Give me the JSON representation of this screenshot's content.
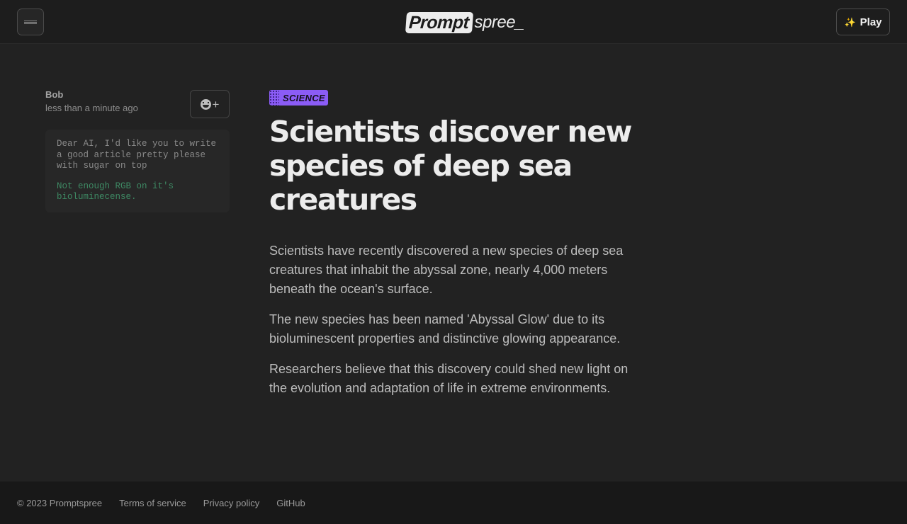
{
  "header": {
    "logo_primary": "Prompt",
    "logo_secondary": "spree_",
    "menu_icon": "hamburger-icon",
    "play_icon": "sparkle-icon",
    "play_label": "Play"
  },
  "sidebar": {
    "author_name": "Bob",
    "timestamp": "less than a minute ago",
    "reaction_icon": "add-reaction-icon",
    "reaction_plus": "+",
    "prompt": "Dear AI, I'd like you to write a good article pretty please with sugar on top",
    "response": "Not enough RGB on it's biolumineсense."
  },
  "article": {
    "category": "SCIENCE",
    "title": "Scientists discover new species of deep sea creatures",
    "paragraphs": [
      "Scientists have recently discovered a new species of deep sea creatures that inhabit the abyssal zone, nearly 4,000 meters beneath the ocean's surface.",
      "The new species has been named 'Abyssal Glow' due to its bioluminescent properties and distinctive glowing appearance.",
      "Researchers believe that this discovery could shed new light on the evolution and adaptation of life in extreme environments."
    ]
  },
  "footer": {
    "copyright": "© 2023 Promptspree",
    "links": [
      "Terms of service",
      "Privacy policy",
      "GitHub"
    ]
  },
  "colors": {
    "background": "#222222",
    "header_bg": "#1d1d1d",
    "footer_bg": "#181818",
    "tag_accent": "#8b5cf6",
    "response_green": "#3e8a64"
  }
}
